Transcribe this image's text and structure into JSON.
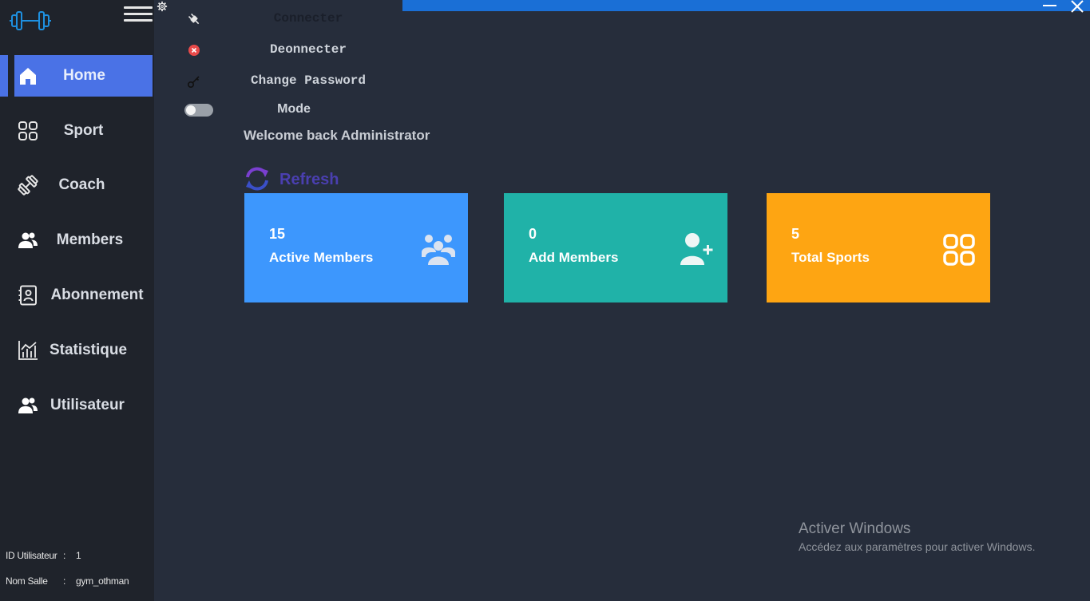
{
  "sidebar": {
    "items": [
      {
        "label": "Home",
        "icon": "home-icon",
        "active": true
      },
      {
        "label": "Sport",
        "icon": "grid-icon"
      },
      {
        "label": "Coach",
        "icon": "dumbbell-icon"
      },
      {
        "label": "Members",
        "icon": "users-icon"
      },
      {
        "label": "Abonnement",
        "icon": "contact-book-icon"
      },
      {
        "label": "Statistique",
        "icon": "stats-chart-icon"
      },
      {
        "label": "Utilisateur",
        "icon": "users-icon"
      }
    ],
    "footer": {
      "id_label": "ID Utilisateur",
      "id_sep": ":",
      "id_value": "1",
      "salle_label": "Nom Salle",
      "salle_sep": ":",
      "salle_value": "gym_othman"
    }
  },
  "menu": {
    "connect": "Connecter",
    "disconnect": "Deonnecter",
    "change_password": "Change Password",
    "mode": "Mode"
  },
  "main": {
    "welcome": "Welcome back Administrator",
    "refresh": "Refresh"
  },
  "cards": [
    {
      "value": "15",
      "label": "Active Members",
      "color": "#3d97fd",
      "icon": "group-icon"
    },
    {
      "value": "0",
      "label": "Add Members",
      "color": "#20b2a8",
      "icon": "add-user-icon"
    },
    {
      "value": "5",
      "label": "Total Sports",
      "color": "#fea512",
      "icon": "grid-icon"
    }
  ],
  "watermark": {
    "title": "Activer Windows",
    "subtitle": "Accédez aux paramètres pour activer Windows."
  },
  "colors": {
    "accent": "#4a72e6",
    "sidebar_bg": "#1f232b",
    "main_bg": "#262d3b",
    "titlebar": "#1a6fd6"
  }
}
